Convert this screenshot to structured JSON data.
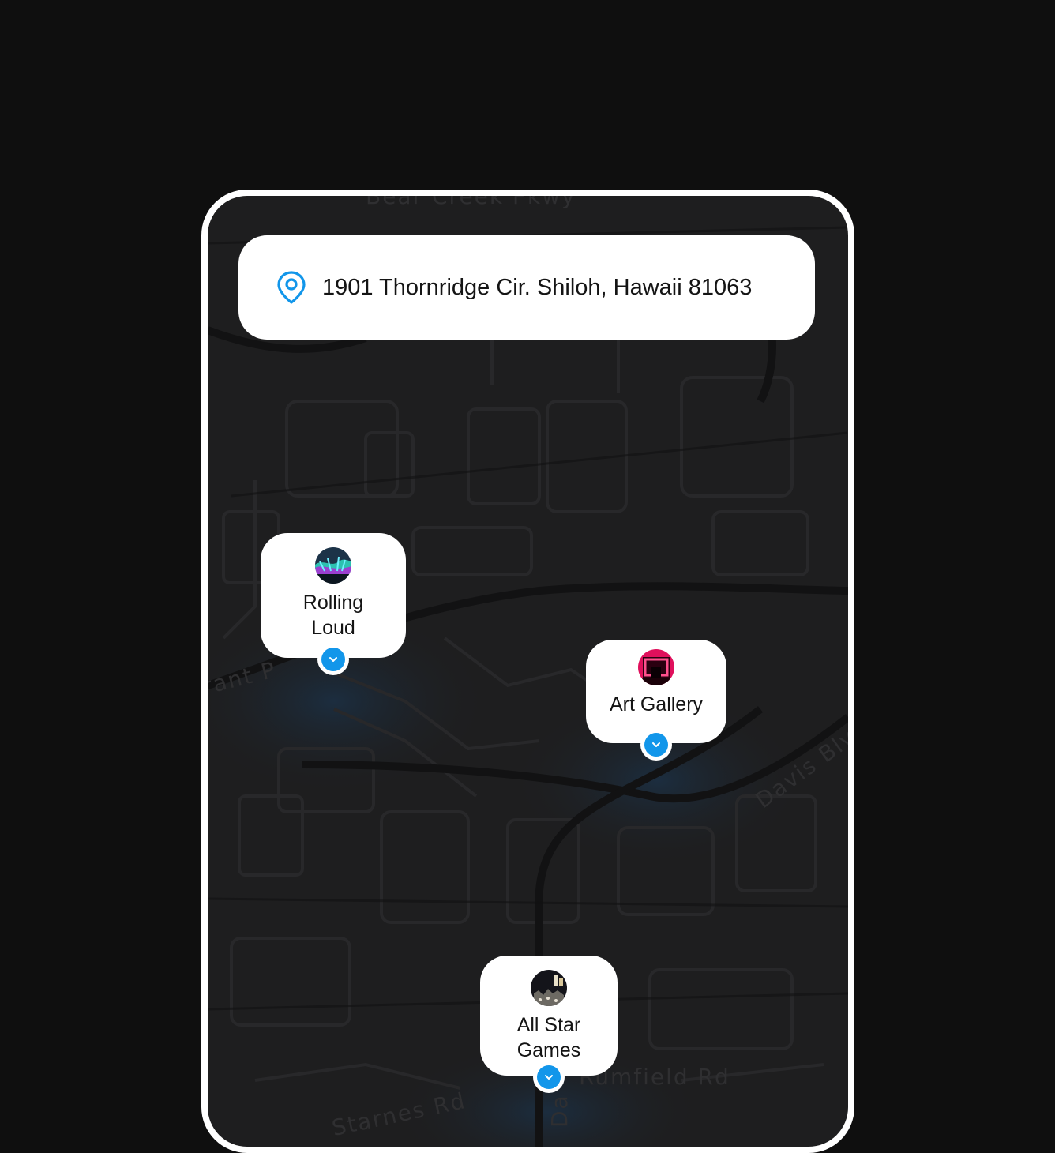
{
  "search": {
    "address": "1901 Thornridge Cir. Shiloh, Hawaii 81063",
    "icon": "location-pin-icon",
    "accent": "#1296ea"
  },
  "map": {
    "streets": [
      "Bear Creek Pkwy",
      "rant P",
      "Davis Blvd",
      "Starnes Rd",
      "Rumfield Rd",
      "Da"
    ]
  },
  "places": [
    {
      "name": "Rolling Loud",
      "line1": "Rolling",
      "line2": "Loud"
    },
    {
      "name": "Art Gallery"
    },
    {
      "name": "All Star Games",
      "line1": "All Star",
      "line2": "Games"
    }
  ],
  "colors": {
    "background": "#0f0f0f",
    "map": "#1e1e1f",
    "card": "#ffffff",
    "accent": "#1296ea"
  }
}
